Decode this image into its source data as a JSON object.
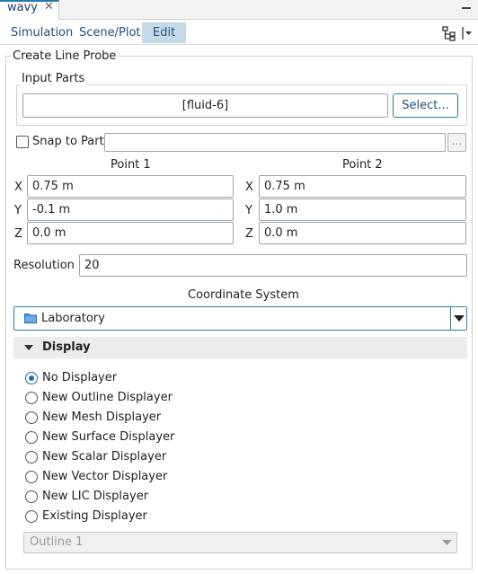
{
  "window": {
    "tab_title": "wavy",
    "close_glyph": "✕"
  },
  "nav": {
    "tabs": [
      "Simulation",
      "Scene/Plot",
      "Edit"
    ],
    "active_tab": "Edit"
  },
  "probe": {
    "group_title": "Create Line Probe",
    "input_parts": {
      "title": "Input Parts",
      "value": "[fluid-6]",
      "select_label": "Select..."
    },
    "snap": {
      "label": "Snap to Part",
      "checked": false,
      "value": "",
      "browse_label": "..."
    },
    "point1": {
      "title": "Point 1",
      "x": "0.75 m",
      "y": "-0.1 m",
      "z": "0.0 m"
    },
    "point2": {
      "title": "Point 2",
      "x": "0.75 m",
      "y": "1.0 m",
      "z": "0.0 m"
    },
    "axis_labels": {
      "x": "X",
      "y": "Y",
      "z": "Z"
    },
    "resolution": {
      "label": "Resolution",
      "value": "20"
    },
    "coordinate_system": {
      "title": "Coordinate System",
      "value": "Laboratory"
    }
  },
  "display": {
    "title": "Display",
    "options": [
      "No Displayer",
      "New Outline Displayer",
      "New Mesh Displayer",
      "New Surface Displayer",
      "New Scalar Displayer",
      "New Vector Displayer",
      "New LIC Displayer",
      "Existing Displayer"
    ],
    "selected_index": 0,
    "existing_select": {
      "value": "Outline 1",
      "disabled": true
    }
  },
  "colors": {
    "accent": "#2a7ab0",
    "tab_active_bg": "#c4dae8",
    "link_text": "#1f4f7a"
  }
}
